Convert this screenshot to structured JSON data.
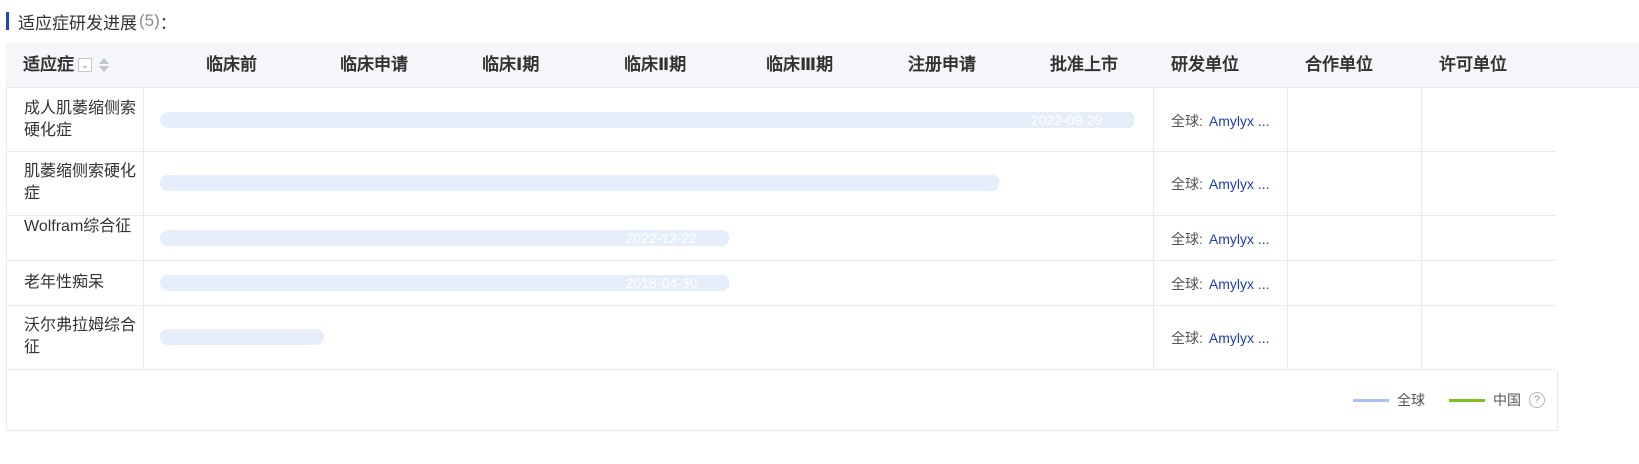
{
  "section": {
    "title": "适应症研发进展",
    "count": "(5)",
    "colon": "："
  },
  "columns": {
    "indication": "适应症",
    "phases": [
      "临床前",
      "临床申请",
      "临床Ⅰ期",
      "临床Ⅱ期",
      "临床Ⅲ期",
      "注册申请",
      "批准上市"
    ],
    "dev_org": "研发单位",
    "partner_org": "合作单位",
    "license_org": "许可单位"
  },
  "icons": {
    "filter": "filter-dropdown-icon",
    "sort": "sort-icon",
    "help": "help-circle-icon"
  },
  "rows": [
    {
      "indication": "成人肌萎缩侧索硬化症",
      "phase_reached": 7,
      "date": "2022-09-29",
      "dev_label": "全球:",
      "dev_name": "Amylyx ..."
    },
    {
      "indication": "肌萎缩侧索硬化症",
      "phase_reached": 6,
      "date": "",
      "dev_label": "全球:",
      "dev_name": "Amylyx ..."
    },
    {
      "indication": "Wolfram综合征",
      "phase_reached": 4,
      "date": "2022-12-22",
      "dev_label": "全球:",
      "dev_name": "Amylyx ..."
    },
    {
      "indication": "老年性痴呆",
      "phase_reached": 4,
      "date": "2018-04-30",
      "dev_label": "全球:",
      "dev_name": "Amylyx ..."
    },
    {
      "indication": "沃尔弗拉姆综合征",
      "phase_reached": 1,
      "date": "",
      "dev_label": "全球:",
      "dev_name": "Amylyx ..."
    }
  ],
  "legend": [
    {
      "label": "全球",
      "color": "#a7bff2"
    },
    {
      "label": "中国",
      "color": "#7cc11f"
    }
  ],
  "colors": {
    "phase_shades": [
      "#e6eefb",
      "#c9daf8",
      "#a9c4f5",
      "#87aef2",
      "#5f91ee",
      "#2e6ae8",
      "#0a2a8c"
    ],
    "accent": "#1e3fd0"
  }
}
